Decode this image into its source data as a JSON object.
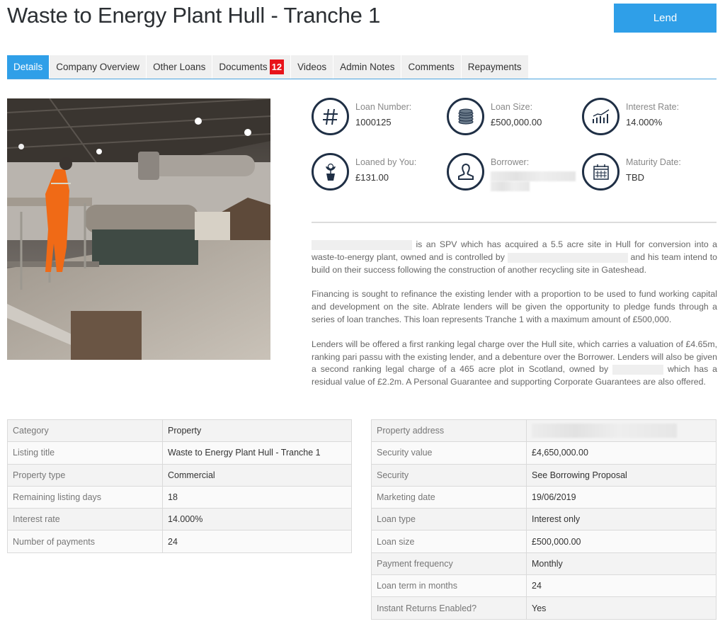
{
  "header": {
    "title": "Waste to Energy Plant Hull - Tranche 1",
    "lend_label": "Lend",
    "accent_color": "#2f9fe8"
  },
  "tabs": [
    {
      "label": "Details",
      "active": true
    },
    {
      "label": "Company Overview"
    },
    {
      "label": "Other Loans"
    },
    {
      "label": "Documents",
      "badge": "12"
    },
    {
      "label": "Videos"
    },
    {
      "label": "Admin Notes"
    },
    {
      "label": "Comments"
    },
    {
      "label": "Repayments"
    }
  ],
  "image": {
    "description": "Worker in orange hi-vis overalls standing on a walkway beside a rotary drum conveyor inside a recycling plant"
  },
  "stats": [
    {
      "icon": "hash-icon",
      "label": "Loan Number:",
      "value": "1000125"
    },
    {
      "icon": "coins-icon",
      "label": "Loan Size:",
      "value": "£500,000.00"
    },
    {
      "icon": "chart-up-icon",
      "label": "Interest Rate:",
      "value": "14.000%"
    },
    {
      "icon": "plant-money-icon",
      "label": "Loaned by You:",
      "value": "£131.00"
    },
    {
      "icon": "user-icon",
      "label": "Borrower:",
      "value": ""
    },
    {
      "icon": "calendar-icon",
      "label": "Maturity Date:",
      "value": "TBD"
    }
  ],
  "description": {
    "p1_part1": "is an SPV which has acquired a 5.5 acre site in Hull for conversion into a waste-to-energy plant, owned and is controlled by",
    "p1_part2": "and his team intend to build on their success following the construction of another recycling site in Gateshead.",
    "p2": "Financing is sought to refinance the existing lender with a proportion to be used to fund working capital and development on the site. Ablrate lenders will be given the opportunity to pledge funds through a series of loan tranches. This loan represents Tranche 1 with a maximum amount of £500,000.",
    "p3_part1": "Lenders will be offered a first ranking legal charge over the Hull site, which carries a valuation of £4.65m, ranking pari passu with the existing lender, and a debenture over the Borrower. Lenders will also be given a second ranking legal charge of a 465 acre plot in Scotland, owned by",
    "p3_part2": "which has a residual value of £2.2m. A Personal Guarantee and supporting Corporate Guarantees are also offered."
  },
  "table_left": [
    {
      "key": "Category",
      "value": "Property"
    },
    {
      "key": "Listing title",
      "value": "Waste to Energy Plant Hull - Tranche 1"
    },
    {
      "key": "Property type",
      "value": "Commercial"
    },
    {
      "key": "Remaining listing days",
      "value": "18"
    },
    {
      "key": "Interest rate",
      "value": "14.000%"
    },
    {
      "key": "Number of payments",
      "value": "24"
    }
  ],
  "table_right": [
    {
      "key": "Property address",
      "value": ""
    },
    {
      "key": "Security value",
      "value": "£4,650,000.00"
    },
    {
      "key": "Security",
      "value": "See Borrowing Proposal"
    },
    {
      "key": "Marketing date",
      "value": "19/06/2019"
    },
    {
      "key": "Loan type",
      "value": "Interest only"
    },
    {
      "key": "Loan size",
      "value": "£500,000.00"
    },
    {
      "key": "Payment frequency",
      "value": "Monthly"
    },
    {
      "key": "Loan term in months",
      "value": "24"
    },
    {
      "key": "Instant Returns Enabled?",
      "value": "Yes"
    }
  ]
}
